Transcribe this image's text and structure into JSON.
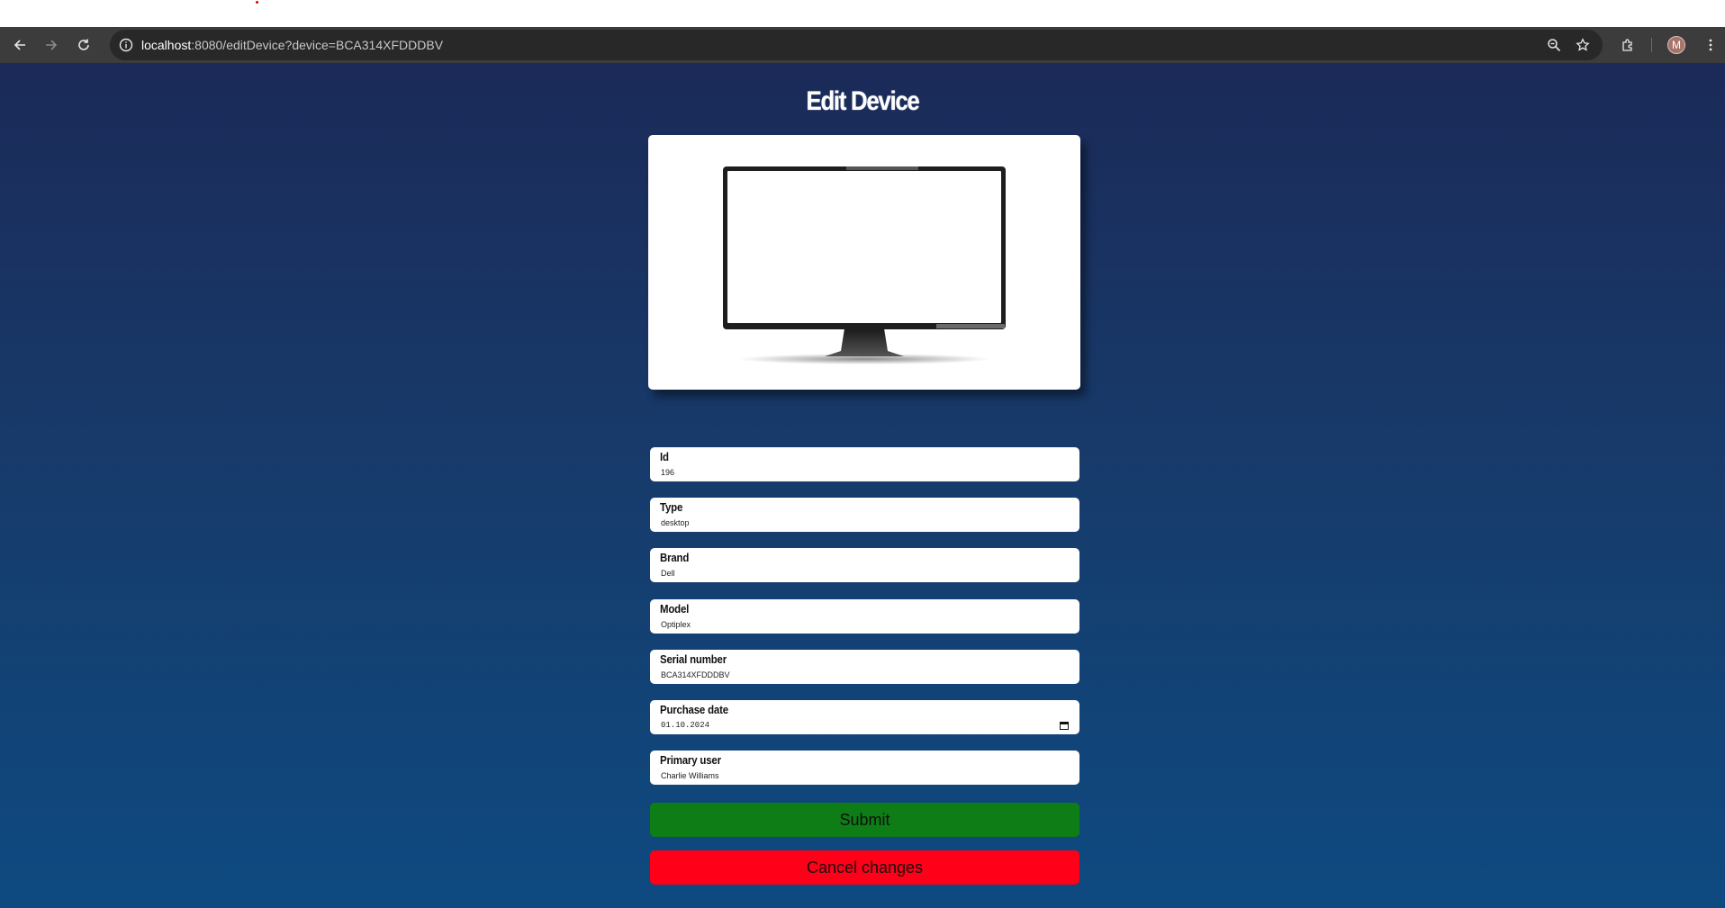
{
  "browser": {
    "url_host": "localhost",
    "url_path": ":8080/editDevice?device=BCA314XFDDDBV",
    "profile_initial": "M"
  },
  "page": {
    "title": "Edit Device",
    "image_alt": "desktop monitor"
  },
  "form": {
    "fields": [
      {
        "label": "Id",
        "value": "196"
      },
      {
        "label": "Type",
        "value": "desktop"
      },
      {
        "label": "Brand",
        "value": "Dell"
      },
      {
        "label": "Model",
        "value": "Optiplex"
      },
      {
        "label": "Serial number",
        "value": "BCA314XFDDDBV"
      },
      {
        "label": "Purchase date",
        "value": "01.10.2024"
      },
      {
        "label": "Primary user",
        "value": "Charlie Williams"
      }
    ],
    "submit_label": "Submit",
    "cancel_label": "Cancel changes"
  },
  "colors": {
    "submit": "#0e7d16",
    "cancel": "#fe0018",
    "background_top": "#1b2a58",
    "background_bottom": "#0e4a80"
  }
}
